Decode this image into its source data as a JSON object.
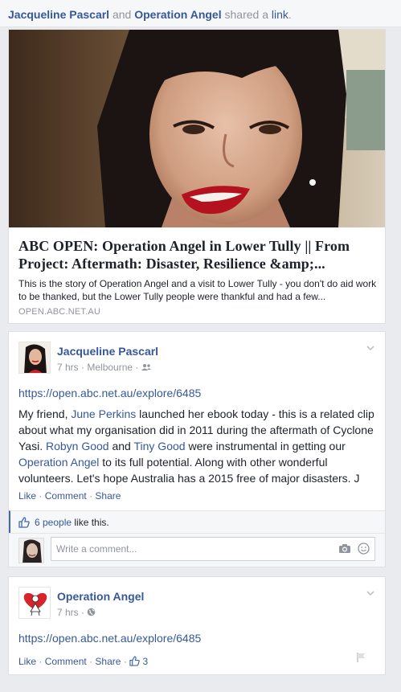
{
  "share_line": {
    "user1": "Jacqueline Pascarl",
    "and": "and",
    "user2": "Operation Angel",
    "verb": "shared a",
    "link_word": "link",
    "period": "."
  },
  "link_preview": {
    "title": "ABC OPEN: Operation Angel in Lower Tully || From Project: Aftermath: Disaster, Resilience &amp;...",
    "description": "This is the story of Operation Angel and a visit to Lower Tully - you don't do aid work to be thanked, but the Lower Tully people were thankful and had a few...",
    "domain": "OPEN.ABC.NET.AU"
  },
  "post1": {
    "author": "Jacqueline Pascarl",
    "time": "7 hrs",
    "location": "Melbourne",
    "url": "https://open.abc.net.au/explore/6485",
    "body": {
      "t1": "My friend, ",
      "m1": "June Perkins",
      "t2": " launched her ebook today - this is a related clip about what my organisation did in 2011 during the aftermath of Cyclone Yasi. ",
      "m2": "Robyn Good",
      "t3": " and ",
      "m3": "Tiny Good",
      "t4": " were instrumental in getting our ",
      "m4": "Operation Angel",
      "t5": " to its full potential. Along with other wonderful volunteers. Let's hope Australia has a 2015 free of major disasters. J"
    },
    "actions": {
      "like": "Like",
      "comment": "Comment",
      "share": "Share",
      "sep": "·"
    },
    "likes": {
      "people": "6 people",
      "suffix": " like this."
    },
    "comment_placeholder": "Write a comment..."
  },
  "post2": {
    "author": "Operation Angel",
    "time": "7 hrs",
    "url": "https://open.abc.net.au/explore/6485",
    "actions": {
      "like": "Like",
      "comment": "Comment",
      "share": "Share",
      "sep": "·"
    },
    "like_count": "3"
  },
  "colors": {
    "link_blue": "#365899",
    "meta_gray": "#90949c",
    "accent": "#4267b2"
  },
  "icons": {
    "chevron": "chevron-down-icon",
    "friends": "friends-icon",
    "globe": "globe-icon",
    "thumb": "thumbs-up-icon",
    "camera": "camera-icon",
    "smile": "emoji-icon",
    "flag": "flag-icon"
  }
}
